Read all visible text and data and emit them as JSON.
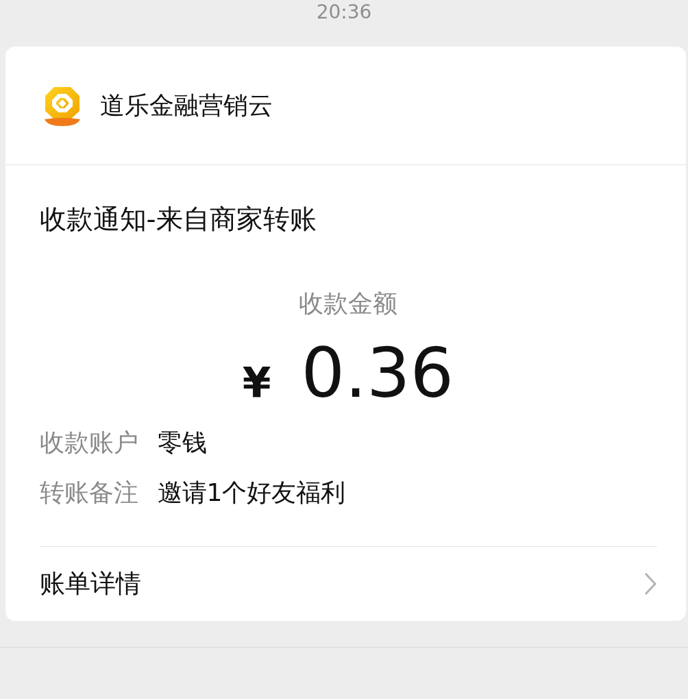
{
  "status_bar": {
    "time": "20:36"
  },
  "card": {
    "sender": "道乐金融营销云",
    "title": "收款通知-来自商家转账",
    "amount_label": "收款金额",
    "currency": "¥",
    "amount": "0.36",
    "fields": [
      {
        "label": "收款账户",
        "value": "零钱"
      },
      {
        "label": "转账备注",
        "value": "邀请1个好友福利"
      }
    ],
    "link": "账单详情"
  }
}
